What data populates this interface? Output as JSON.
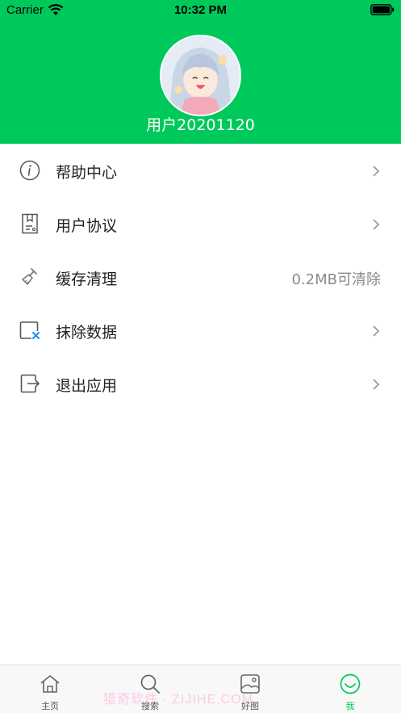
{
  "status_bar": {
    "carrier": "Carrier",
    "time": "10:32 PM"
  },
  "profile": {
    "username": "用户20201120"
  },
  "menu": [
    {
      "label": "帮助中心",
      "icon": "info-icon"
    },
    {
      "label": "用户协议",
      "icon": "document-icon"
    },
    {
      "label": "缓存清理",
      "icon": "brush-icon",
      "value": "0.2MB可清除"
    },
    {
      "label": "抹除数据",
      "icon": "erase-icon"
    },
    {
      "label": "退出应用",
      "icon": "exit-icon"
    }
  ],
  "tabbar": {
    "tabs": [
      {
        "label": "主页",
        "icon": "home-icon"
      },
      {
        "label": "搜索",
        "icon": "search-icon"
      },
      {
        "label": "好图",
        "icon": "picture-icon"
      },
      {
        "label": "我",
        "icon": "me-icon"
      }
    ],
    "active": "我"
  },
  "watermark": "猎奇软件 · ZIJIHE.COM",
  "colors": {
    "brand": "#00c95b",
    "text": "#222222",
    "muted": "#8a8a8a",
    "erase_accent": "#1a8cff"
  }
}
